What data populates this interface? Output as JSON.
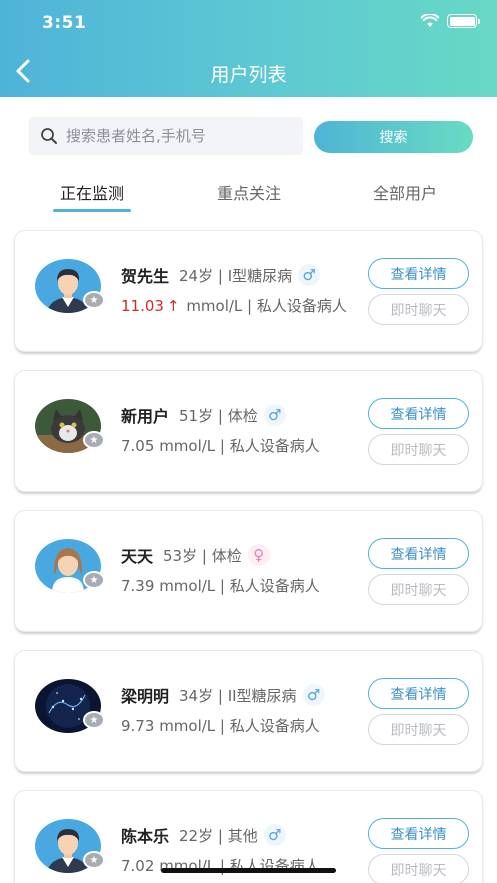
{
  "status_bar": {
    "time": "3:51"
  },
  "nav": {
    "title": "用户列表"
  },
  "search": {
    "placeholder": "搜索患者姓名,手机号",
    "button_label": "搜索"
  },
  "tabs": [
    {
      "label": "正在监测",
      "active": true
    },
    {
      "label": "重点关注",
      "active": false
    },
    {
      "label": "全部用户",
      "active": false
    }
  ],
  "colors": {
    "accent": "#4fb3d9",
    "gradient_end": "#68d8c5",
    "high_value": "#d02c2c",
    "male": "#4fa3e0",
    "female": "#f07bb0"
  },
  "users": [
    {
      "name": "贺先生",
      "age_info": "24岁 | I型糖尿病",
      "gender": "male",
      "gender_icon": "♂",
      "glucose": "11.03",
      "glucose_high": true,
      "arrow": "↑",
      "unit_info": "mmol/L | 私人设备病人",
      "avatar": "man-avatar",
      "detail_label": "查看详情",
      "chat_label": "即时聊天"
    },
    {
      "name": "新用户",
      "age_info": "51岁 | 体检",
      "gender": "male",
      "gender_icon": "♂",
      "glucose": "7.05",
      "glucose_high": false,
      "arrow": "",
      "unit_info": "mmol/L | 私人设备病人",
      "avatar": "cat-photo",
      "detail_label": "查看详情",
      "chat_label": "即时聊天"
    },
    {
      "name": "天天",
      "age_info": "53岁 | 体检",
      "gender": "female",
      "gender_icon": "♀",
      "glucose": "7.39",
      "glucose_high": false,
      "arrow": "",
      "unit_info": "mmol/L | 私人设备病人",
      "avatar": "woman-avatar",
      "detail_label": "查看详情",
      "chat_label": "即时聊天"
    },
    {
      "name": "梁明明",
      "age_info": "34岁 | II型糖尿病",
      "gender": "male",
      "gender_icon": "♂",
      "glucose": "9.73",
      "glucose_high": false,
      "arrow": "",
      "unit_info": "mmol/L | 私人设备病人",
      "avatar": "starry-photo",
      "detail_label": "查看详情",
      "chat_label": "即时聊天"
    },
    {
      "name": "陈本乐",
      "age_info": "22岁 | 其他",
      "gender": "male",
      "gender_icon": "♂",
      "glucose": "7.02",
      "glucose_high": false,
      "arrow": "",
      "unit_info": "mmol/L | 私人设备病人",
      "avatar": "man-avatar",
      "detail_label": "查看详情",
      "chat_label": "即时聊天"
    }
  ]
}
